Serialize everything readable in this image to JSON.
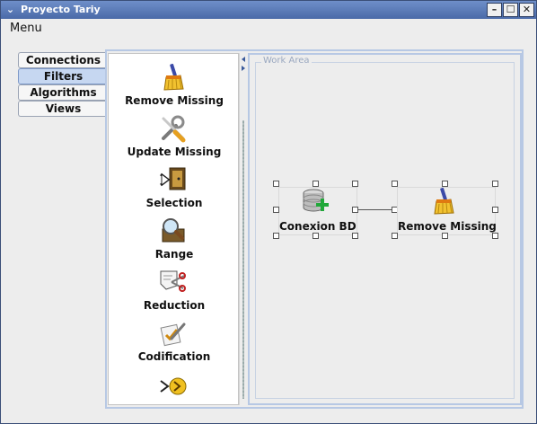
{
  "window": {
    "title": "Proyecto Tariy"
  },
  "titlebar_buttons": {
    "system": "⌄",
    "minimize": "–",
    "maximize": "☐",
    "close": "✕"
  },
  "menu": {
    "items": [
      {
        "label": "Menu"
      }
    ]
  },
  "tabs": [
    {
      "label": "Connections",
      "active": false
    },
    {
      "label": "Filters",
      "active": true
    },
    {
      "label": "Algorithms",
      "active": false
    },
    {
      "label": "Views",
      "active": false
    }
  ],
  "palette": {
    "tools": [
      {
        "label": "Remove Missing",
        "icon": "broom-icon"
      },
      {
        "label": "Update Missing",
        "icon": "tools-icon"
      },
      {
        "label": "Selection",
        "icon": "selection-icon"
      },
      {
        "label": "Range",
        "icon": "range-magnifier-icon"
      },
      {
        "label": "Reduction",
        "icon": "reduction-scissors-icon"
      },
      {
        "label": "Codification",
        "icon": "codification-icon"
      },
      {
        "label": "",
        "icon": "arrow-plug-icon"
      }
    ]
  },
  "workarea": {
    "legend": "Work Area",
    "nodes": [
      {
        "label": "Conexion BD",
        "icon": "database-add-icon"
      },
      {
        "label": "Remove Missing",
        "icon": "broom-icon"
      }
    ]
  },
  "colors": {
    "title_bar": "#5577b5",
    "selected_tab": "#c6d7f1",
    "frame_border": "#b7c8e4"
  }
}
